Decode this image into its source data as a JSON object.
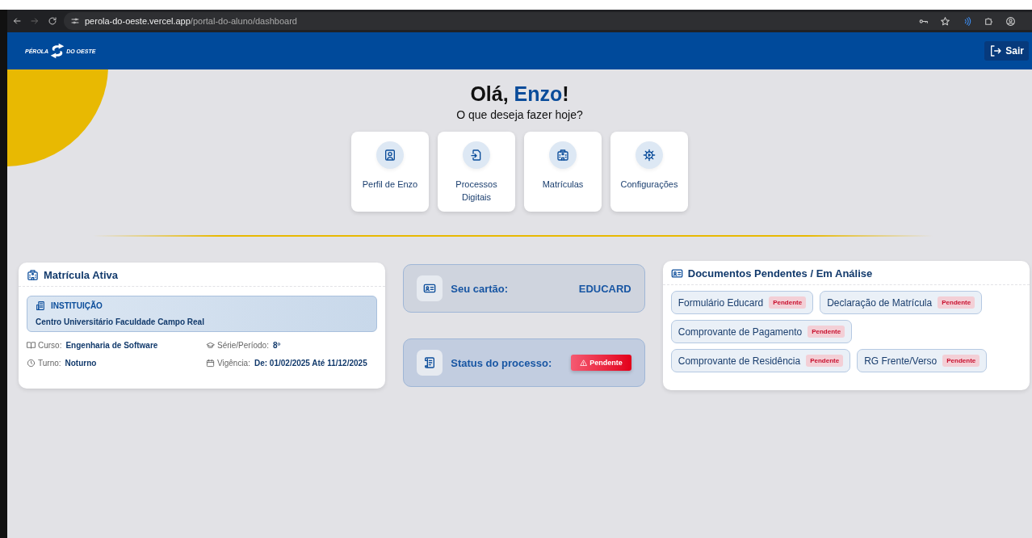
{
  "browser": {
    "host": "perola-do-oeste.vercel.app",
    "path": "/portal-do-aluno/dashboard"
  },
  "header": {
    "logo_left": "PÉROLA",
    "logo_right": "DO OESTE",
    "logout": "Sair"
  },
  "greeting": {
    "prefix": "Olá, ",
    "name": "Enzo",
    "suffix": "!",
    "subtitle": "O que deseja fazer hoje?"
  },
  "actions": [
    {
      "kind": "profile",
      "label": "Perfil de Enzo"
    },
    {
      "kind": "process",
      "label": "Processos Digitais"
    },
    {
      "kind": "building",
      "label": "Matrículas"
    },
    {
      "kind": "gear",
      "label": "Configurações"
    }
  ],
  "enrollment": {
    "title": "Matrícula Ativa",
    "institution_label": "INSTITUIÇÃO",
    "institution": "Centro Universitário Faculdade Campo Real",
    "fields": [
      {
        "kind": "book",
        "label": "Curso:",
        "value": "Engenharia de Software"
      },
      {
        "kind": "cap",
        "label": "Série/Período:",
        "value": "8º"
      },
      {
        "kind": "clock",
        "label": "Turno:",
        "value": "Noturno"
      },
      {
        "kind": "calendar",
        "label": "Vigência:",
        "value": "De: 01/02/2025 Até 11/12/2025"
      }
    ]
  },
  "card": {
    "label": "Seu cartão:",
    "value": "EDUCARD"
  },
  "status": {
    "label": "Status do processo:",
    "value": "Pendente"
  },
  "documents": {
    "title": "Documentos Pendentes / Em Análise",
    "items": [
      {
        "name": "Formulário Educard",
        "status": "Pendente"
      },
      {
        "name": "Declaração de Matrícula",
        "status": "Pendente"
      },
      {
        "name": "Comprovante de Pagamento",
        "status": "Pendente"
      },
      {
        "name": "Comprovante de Residência",
        "status": "Pendente"
      },
      {
        "name": "RG Frente/Verso",
        "status": "Pendente"
      }
    ]
  }
}
